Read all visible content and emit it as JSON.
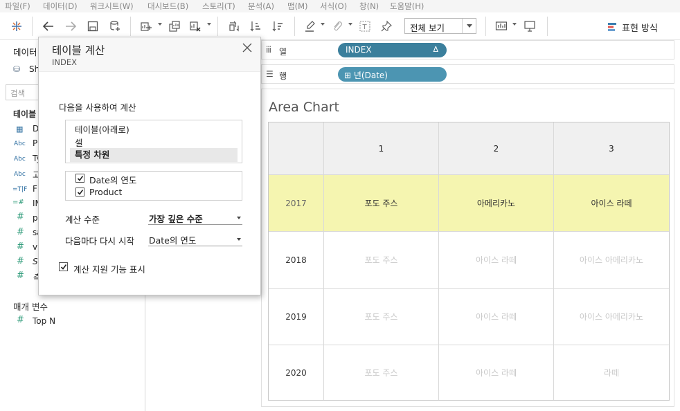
{
  "menu": [
    "파일(F)",
    "데이터(D)",
    "워크시트(W)",
    "대시보드(B)",
    "스토리(T)",
    "분석(A)",
    "맵(M)",
    "서식(O)",
    "창(N)",
    "도움말(H)"
  ],
  "toolbar": {
    "fit_label": "전체 보기",
    "show_me_label": "표현 방식"
  },
  "left_pane": {
    "data_header": "데이터",
    "datasource_label": "Sh",
    "search_placeholder": "검색",
    "tables_header": "테이블",
    "fields": [
      {
        "type": "date",
        "label": "D"
      },
      {
        "type": "Abc",
        "label": "P"
      },
      {
        "type": "Abc",
        "label": "Ty"
      },
      {
        "type": "Abc",
        "label": "고"
      },
      {
        "type": "=T|F",
        "label": "F"
      },
      {
        "type": "=#",
        "label": "IN"
      },
      {
        "type": "#",
        "label": "p"
      },
      {
        "type": "#",
        "label": "sa"
      },
      {
        "type": "#",
        "label": "vi"
      },
      {
        "type": "#",
        "label": "S"
      },
      {
        "type": "#",
        "label": "측"
      }
    ],
    "params_header": "매개 변수",
    "params": [
      {
        "type": "#",
        "label": "Top N"
      }
    ]
  },
  "shelves": {
    "columns": {
      "label": "열",
      "pill": "INDEX",
      "pill_badge": "Δ"
    },
    "rows": {
      "label": "행",
      "pill": "년(Date)",
      "pill_prefix": "⊞"
    }
  },
  "viz": {
    "title": "Area Chart",
    "col_headers": [
      "1",
      "2",
      "3"
    ],
    "rows": [
      {
        "year": "2017",
        "cells": [
          "포도 주스",
          "아메리카노",
          "아이스 라떼"
        ],
        "highlight": true
      },
      {
        "year": "2018",
        "cells": [
          "포도 주스",
          "아이스 라떼",
          "아이스 아메리카노"
        ],
        "highlight": false
      },
      {
        "year": "2019",
        "cells": [
          "포도 주스",
          "아이스 라떼",
          "아이스 아메리카노"
        ],
        "highlight": false
      },
      {
        "year": "2020",
        "cells": [
          "포도 주스",
          "아이스 라떼",
          "라떼"
        ],
        "highlight": false
      }
    ]
  },
  "dialog": {
    "title": "테이블 계산",
    "subtitle": "INDEX",
    "compute_using_label": "다음을 사용하여 계산",
    "compute_options": [
      "테이블(아래로)",
      "셀",
      "특정 차원"
    ],
    "selected_option": "특정 차원",
    "dimensions": [
      {
        "label": "Date의 연도",
        "checked": true
      },
      {
        "label": "Product",
        "checked": true
      }
    ],
    "level_label": "계산 수준",
    "level_value": "가장 깊은 수준",
    "restart_label": "다음마다 다시 시작",
    "restart_value": "Date의 연도",
    "show_assist_label": "계산 지원 기능 표시",
    "show_assist_checked": true
  },
  "colors": {
    "pill_blue": "#3f86a6",
    "highlight_row": "#f5f5b0"
  }
}
